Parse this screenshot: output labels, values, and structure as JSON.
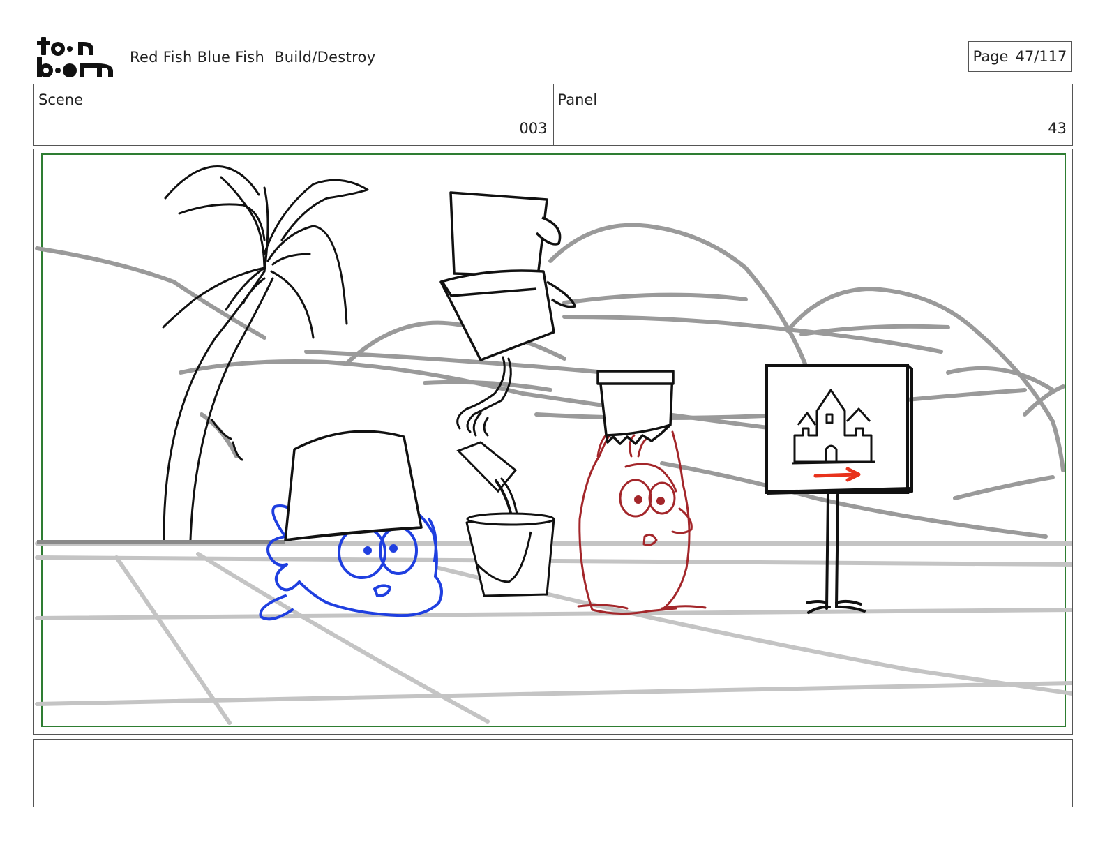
{
  "header": {
    "logo_text": "toonboom",
    "project_title": "Red Fish Blue Fish  Build/Destroy",
    "page_label": "Page",
    "page_value": "47/117"
  },
  "info": {
    "scene_label": "Scene",
    "scene_value": "003",
    "panel_label": "Panel",
    "panel_value": "43"
  },
  "colors": {
    "safe_frame": "#2e7d32",
    "blue_fish": "#1f3fe0",
    "red_fish": "#a3262a",
    "sign_arrow": "#e8321c",
    "background_lines": "#9a9a9a",
    "ground_lines": "#c4c4c4"
  },
  "notes": {
    "text": ""
  }
}
